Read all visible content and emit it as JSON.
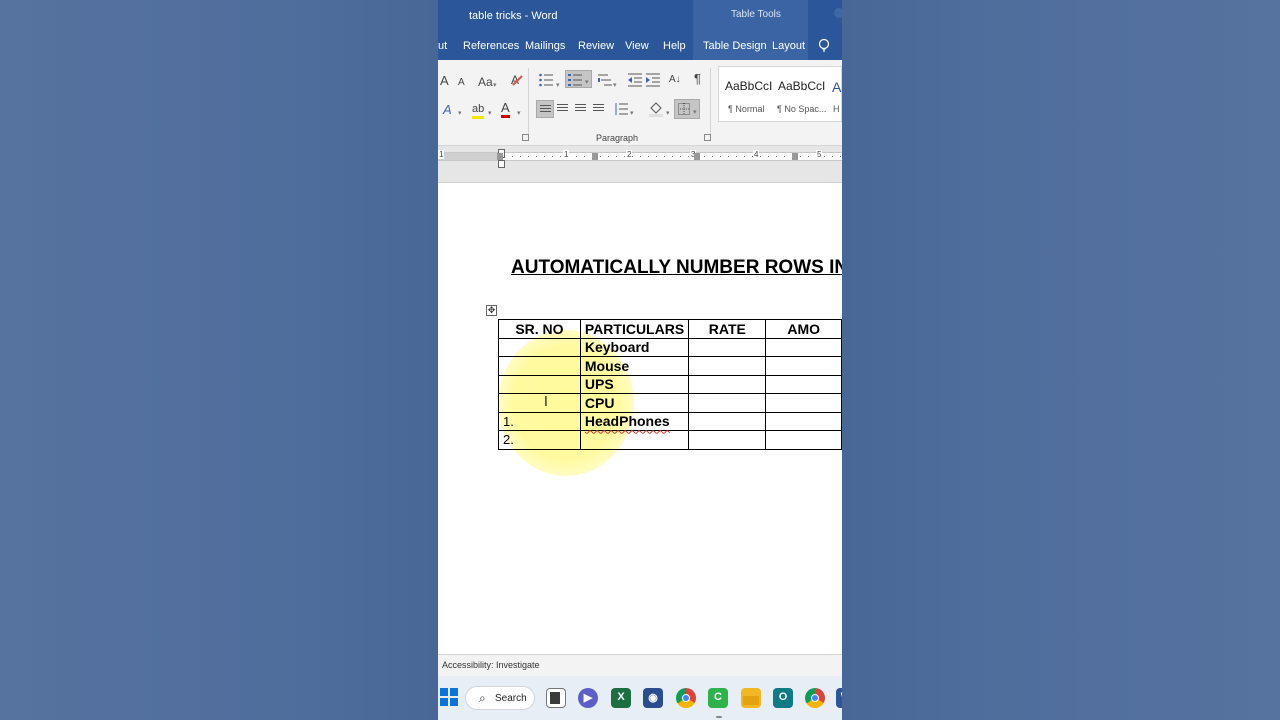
{
  "window": {
    "doc_title": "table tricks",
    "app_name": "Word",
    "contextual_group": "Table Tools"
  },
  "tabs": [
    "ut",
    "References",
    "Mailings",
    "Review",
    "View",
    "Help",
    "Table Design",
    "Layout"
  ],
  "ribbon": {
    "font_tools": {
      "grow_label": "A",
      "shrink_label": "A",
      "case_label": "Aa",
      "effects_label": "A",
      "highlight_label": "ab",
      "color_label": "A"
    },
    "paragraph_group_label": "Paragraph",
    "pilcrow": "¶",
    "sort_label": "A↓",
    "styles": [
      {
        "sample": "AaBbCcI",
        "name": "¶ Normal"
      },
      {
        "sample": "AaBbCcI",
        "name": "¶ No Spac..."
      },
      {
        "sample": "A",
        "name": "H"
      }
    ]
  },
  "ruler": {
    "numbers": [
      "1",
      "1",
      "2",
      "3",
      "4",
      "5"
    ]
  },
  "document": {
    "heading": "AUTOMATICALLY NUMBER ROWS IN TA",
    "table": {
      "headers": [
        "SR. NO",
        "PARTICULARS",
        "RATE",
        "AMO"
      ],
      "rows": [
        [
          "",
          "Keyboard",
          "",
          ""
        ],
        [
          "",
          "Mouse",
          "",
          ""
        ],
        [
          "",
          "UPS",
          "",
          ""
        ],
        [
          "",
          "CPU",
          "",
          ""
        ],
        [
          "1.",
          "HeadPhones",
          "",
          ""
        ],
        [
          "2.",
          "",
          "",
          ""
        ]
      ]
    }
  },
  "statusbar": {
    "accessibility": "Accessibility: Investigate"
  },
  "taskbar": {
    "search_label": "Search",
    "apps": [
      {
        "name": "task-view",
        "color": "#3b3b3b"
      },
      {
        "name": "teams",
        "color": "#5b5fc7"
      },
      {
        "name": "excel",
        "color": "#1d6f42"
      },
      {
        "name": "media-player",
        "color": "#2a4d8f"
      },
      {
        "name": "chrome",
        "color": "#db4437"
      },
      {
        "name": "camtasia",
        "color": "#2db34a"
      },
      {
        "name": "file-explorer",
        "color": "#f2b824"
      },
      {
        "name": "app-o",
        "color": "#0f7b86"
      },
      {
        "name": "chrome-2",
        "color": "#db4437"
      },
      {
        "name": "word",
        "color": "#2b579a"
      }
    ],
    "colors": {
      "windows_blue": "#0a74da"
    }
  },
  "colors": {
    "word_blue": "#2b579a",
    "highlight_yellow": "#fffa96"
  }
}
